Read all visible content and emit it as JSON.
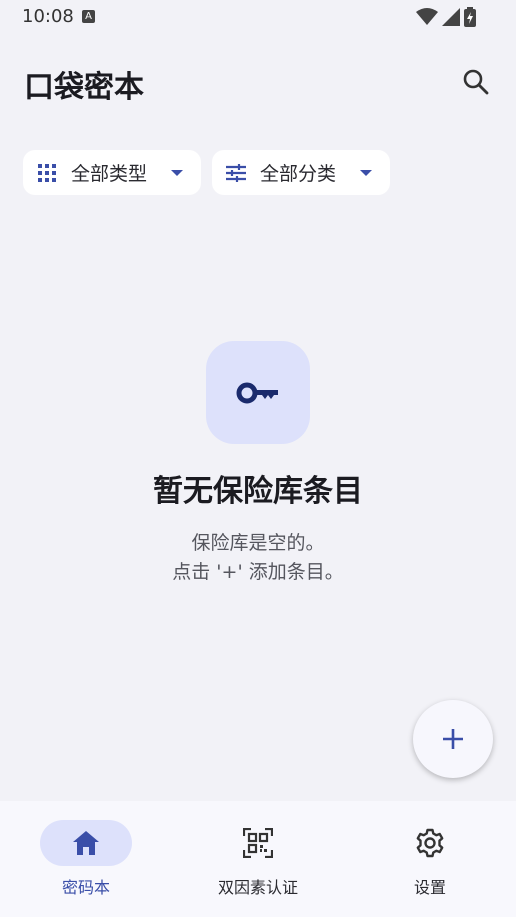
{
  "status_bar": {
    "time": "10:08",
    "notification_glyph": "A"
  },
  "app_bar": {
    "title": "口袋密本",
    "search_icon": "search-icon"
  },
  "filters": {
    "type_chip": {
      "label": "全部类型",
      "icon": "grid-icon"
    },
    "category_chip": {
      "label": "全部分类",
      "icon": "tune-icon"
    }
  },
  "empty_state": {
    "icon": "key-icon",
    "title": "暂无保险库条目",
    "line1": "保险库是空的。",
    "line2": "点击 '+' 添加条目。"
  },
  "fab": {
    "icon": "add-icon"
  },
  "bottom_nav": {
    "items": [
      {
        "label": "密码本",
        "icon": "home-icon",
        "active": true
      },
      {
        "label": "双因素认证",
        "icon": "qr-scan-icon",
        "active": false
      },
      {
        "label": "设置",
        "icon": "gear-icon",
        "active": false
      }
    ]
  },
  "colors": {
    "accent": "#3a4ea8",
    "background": "#f2f2f7",
    "icon_container": "#dde1fb",
    "key_icon": "#1a2a6c"
  }
}
